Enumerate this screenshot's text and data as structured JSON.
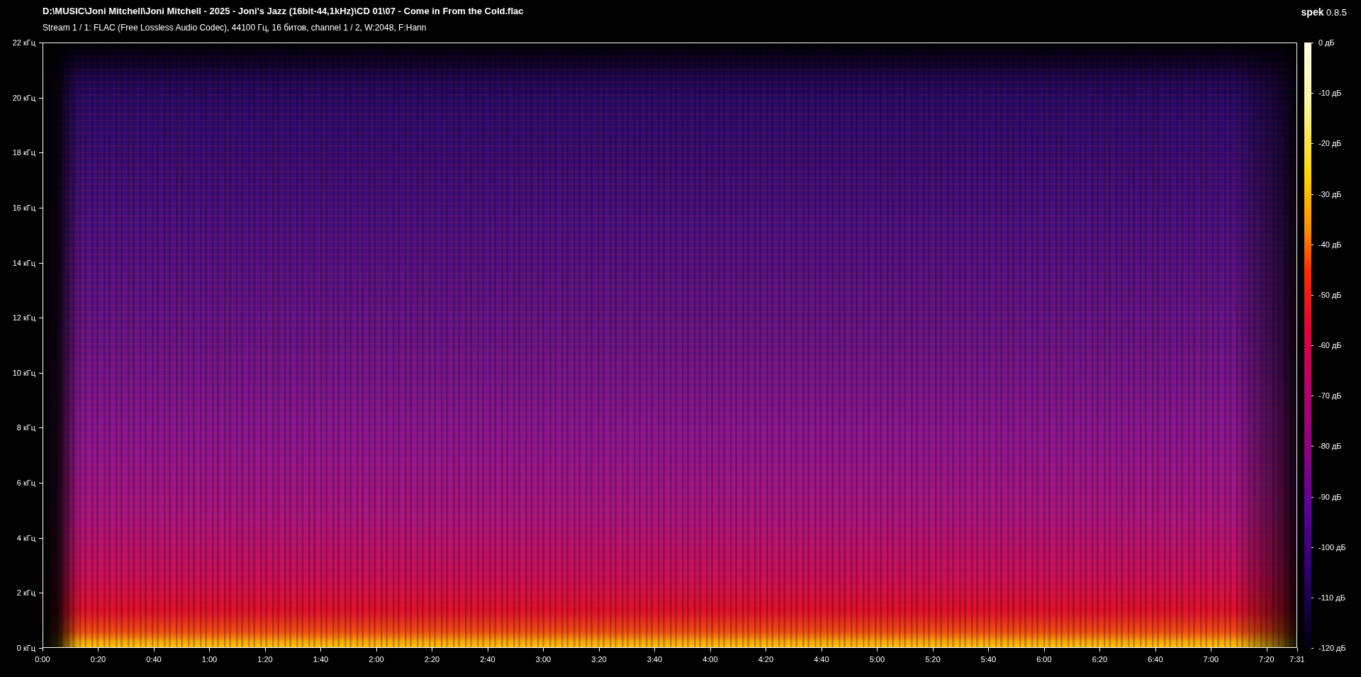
{
  "header": {
    "file_path": "D:\\MUSIC\\Joni Mitchell\\Joni Mitchell - 2025 - Joni's Jazz (16bit-44,1kHz)\\CD 01\\07 - Come in From the Cold.flac",
    "stream_info": "Stream 1 / 1: FLAC (Free Lossless Audio Codec), 44100 Гц, 16 битов, channel 1 / 2, W:2048, F:Hann",
    "app_label": "**spek** 0.8.5"
  },
  "frequency_axis": {
    "ticks": [
      "22 кГц",
      "20 кГц",
      "18 кГц",
      "16 кГц",
      "14 кГц",
      "12 кГц",
      "10 кГц",
      "8 кГц",
      "6 кГц",
      "4 кГц",
      "2 кГц",
      "0 кГц"
    ]
  },
  "time_axis": {
    "ticks": [
      "0:00",
      "0:20",
      "0:40",
      "1:00",
      "1:20",
      "1:40",
      "2:00",
      "2:20",
      "2:40",
      "3:00",
      "3:20",
      "3:40",
      "4:00",
      "4:20",
      "4:40",
      "5:00",
      "5:20",
      "5:40",
      "6:00",
      "6:20",
      "6:40",
      "7:00",
      "7:20"
    ],
    "end_label": "7:31"
  },
  "level_scale": {
    "ticks": [
      "0 дБ",
      "-10 дБ",
      "-20 дБ",
      "-30 дБ",
      "-40 дБ",
      "-50 дБ",
      "-60 дБ",
      "-70 дБ",
      "-80 дБ",
      "-90 дБ",
      "-100 дБ",
      "-110 дБ",
      "-120 дБ"
    ]
  }
}
